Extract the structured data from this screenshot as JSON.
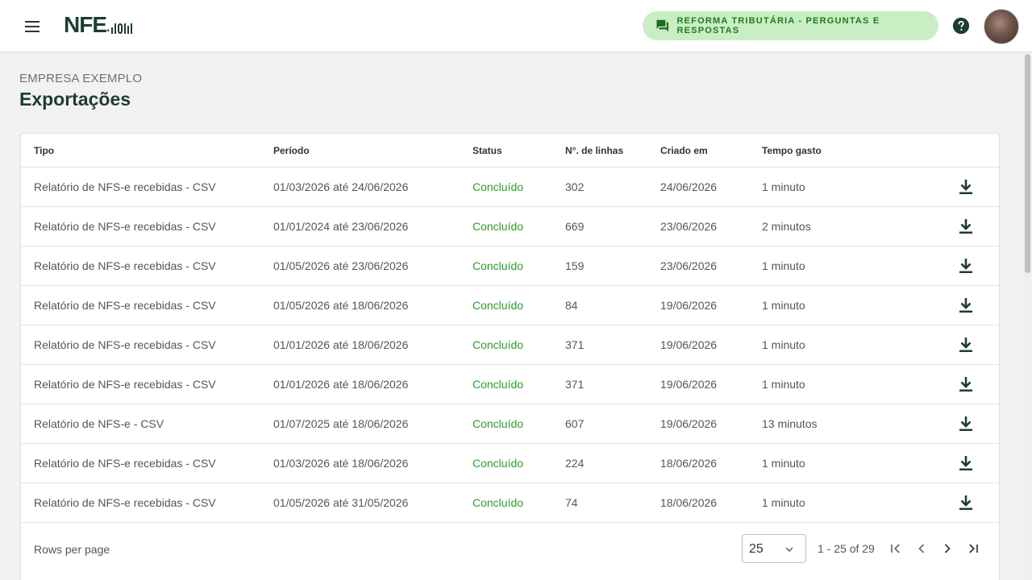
{
  "header": {
    "logo_text": "NFE",
    "logo_suffix": ".io",
    "reforma_label": "REFORMA TRIBUTÁRIA - PERGUNTAS E RESPOSTAS",
    "accent": "#c9eec4"
  },
  "page": {
    "company": "EMPRESA EXEMPLO",
    "title": "Exportações"
  },
  "table": {
    "columns": [
      "Tipo",
      "Período",
      "Status",
      "N°. de linhas",
      "Criado em",
      "Tempo gasto"
    ],
    "rows": [
      {
        "tipo": "Relatório de NFS-e recebidas - CSV",
        "periodo": "01/03/2026 até 24/06/2026",
        "status": "Concluído",
        "linhas": "302",
        "criado": "24/06/2026",
        "tempo": "1 minuto"
      },
      {
        "tipo": "Relatório de NFS-e recebidas - CSV",
        "periodo": "01/01/2024 até 23/06/2026",
        "status": "Concluído",
        "linhas": "669",
        "criado": "23/06/2026",
        "tempo": "2 minutos"
      },
      {
        "tipo": "Relatório de NFS-e recebidas - CSV",
        "periodo": "01/05/2026 até 23/06/2026",
        "status": "Concluído",
        "linhas": "159",
        "criado": "23/06/2026",
        "tempo": "1 minuto"
      },
      {
        "tipo": "Relatório de NFS-e recebidas - CSV",
        "periodo": "01/05/2026 até 18/06/2026",
        "status": "Concluído",
        "linhas": "84",
        "criado": "19/06/2026",
        "tempo": "1 minuto"
      },
      {
        "tipo": "Relatório de NFS-e recebidas - CSV",
        "periodo": "01/01/2026 até 18/06/2026",
        "status": "Concluído",
        "linhas": "371",
        "criado": "19/06/2026",
        "tempo": "1 minuto"
      },
      {
        "tipo": "Relatório de NFS-e recebidas - CSV",
        "periodo": "01/01/2026 até 18/06/2026",
        "status": "Concluído",
        "linhas": "371",
        "criado": "19/06/2026",
        "tempo": "1 minuto"
      },
      {
        "tipo": "Relatório de NFS-e - CSV",
        "periodo": "01/07/2025 até 18/06/2026",
        "status": "Concluído",
        "linhas": "607",
        "criado": "19/06/2026",
        "tempo": "13 minutos"
      },
      {
        "tipo": "Relatório de NFS-e recebidas - CSV",
        "periodo": "01/03/2026 até 18/06/2026",
        "status": "Concluído",
        "linhas": "224",
        "criado": "18/06/2026",
        "tempo": "1 minuto"
      },
      {
        "tipo": "Relatório de NFS-e recebidas - CSV",
        "periodo": "01/05/2026 até 31/05/2026",
        "status": "Concluído",
        "linhas": "74",
        "criado": "18/06/2026",
        "tempo": "1 minuto"
      }
    ]
  },
  "pagination": {
    "rows_per_page_label": "Rows per page",
    "rows_per_page": "25",
    "range": "1 - 25 of 29"
  },
  "icons": {
    "menu": "menu-icon",
    "chat": "chat-icon",
    "help": "help-icon",
    "download": "download-icon",
    "first": "first-page-icon",
    "prev": "chevron-left-icon",
    "next": "chevron-right-icon",
    "last": "last-page-icon"
  },
  "colors": {
    "status_done": "#2e9a2e",
    "brand_dark": "#1f3b36",
    "reforma_text": "#1f7a1f"
  }
}
